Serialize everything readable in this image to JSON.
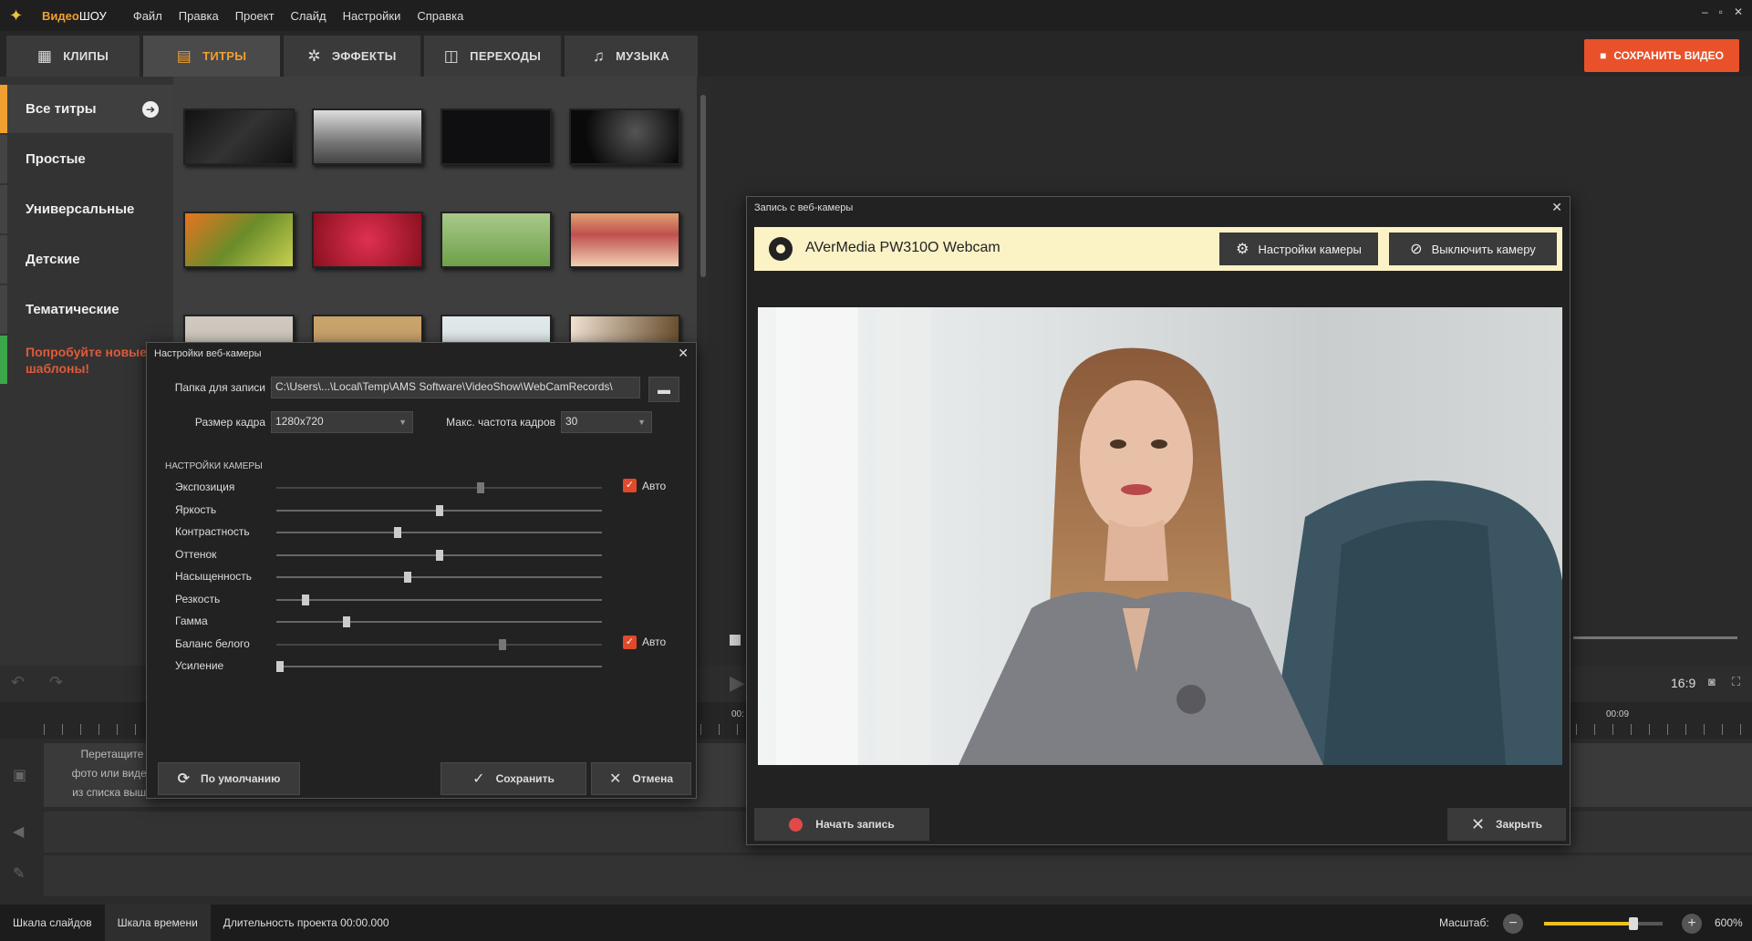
{
  "app": {
    "name_brand": "Видео",
    "name_rest": "ШОУ"
  },
  "menu": [
    "Файл",
    "Правка",
    "Проект",
    "Слайд",
    "Настройки",
    "Справка"
  ],
  "window_controls": {
    "minimize": "–",
    "restore": "▫",
    "close": "✕"
  },
  "tabs": [
    {
      "label": "КЛИПЫ",
      "icon": "film-icon"
    },
    {
      "label": "ТИТРЫ",
      "icon": "titles-icon"
    },
    {
      "label": "ЭФФЕКТЫ",
      "icon": "effects-icon"
    },
    {
      "label": "ПЕРЕХОДЫ",
      "icon": "transitions-icon"
    },
    {
      "label": "МУЗЫКА",
      "icon": "music-icon"
    }
  ],
  "save_video_label": "СОХРАНИТЬ ВИДЕО",
  "categories": [
    "Все титры",
    "Простые",
    "Универсальные",
    "Детские",
    "Тематические"
  ],
  "promo": "Попробуйте новые шаблоны!",
  "timeline": {
    "hint_1": "Перетащите",
    "hint_2": "фото или видео",
    "hint_3": "из списка выше",
    "time_1": "00:",
    "time_2": "00:09",
    "aspect": "16:9"
  },
  "status": {
    "tab_slides": "Шкала слайдов",
    "tab_timeline": "Шкала времени",
    "duration": "Длительность проекта 00:00.000",
    "zoom_label": "Масштаб:",
    "zoom_value": "600%",
    "zoom_level_percent": 75
  },
  "settings_dialog": {
    "title": "Настройки веб-камеры",
    "folder_label": "Папка для записи",
    "folder_value": "C:\\Users\\...\\Local\\Temp\\AMS Software\\VideoShow\\WebCamRecords\\",
    "frame_size_label": "Размер кадра",
    "frame_size_value": "1280x720",
    "fps_label": "Макс. частота кадров",
    "fps_value": "30",
    "section": "НАСТРОЙКИ КАМЕРЫ",
    "sliders": [
      {
        "label": "Экспозиция",
        "value_percent": 63,
        "auto": true
      },
      {
        "label": "Яркость",
        "value_percent": 50
      },
      {
        "label": "Контрастность",
        "value_percent": 37
      },
      {
        "label": "Оттенок",
        "value_percent": 50
      },
      {
        "label": "Насыщенность",
        "value_percent": 40
      },
      {
        "label": "Резкость",
        "value_percent": 8
      },
      {
        "label": "Гамма",
        "value_percent": 21
      },
      {
        "label": "Баланс белого",
        "value_percent": 70,
        "auto": true
      },
      {
        "label": "Усиление",
        "value_percent": 0
      }
    ],
    "auto_label": "Авто",
    "default_btn": "По умолчанию",
    "save_btn": "Сохранить",
    "cancel_btn": "Отмена"
  },
  "camera_dialog": {
    "title": "Запись с веб-камеры",
    "camera_name": "AVerMedia PW310O Webcam",
    "camera_settings_btn": "Настройки камеры",
    "disable_camera_btn": "Выключить камеру",
    "start_record_btn": "Начать запись",
    "close_btn": "Закрыть"
  }
}
